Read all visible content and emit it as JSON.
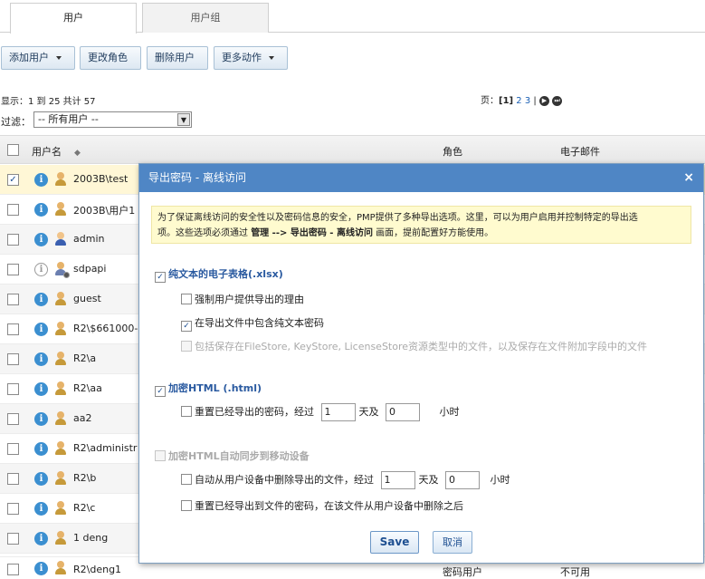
{
  "tabs": [
    {
      "label": "用户"
    },
    {
      "label": "用户组"
    }
  ],
  "toolbar": {
    "add_user": "添加用户",
    "change_role": "更改角色",
    "delete_user": "删除用户",
    "more_actions": "更多动作"
  },
  "status": {
    "showing": "显示：1 到 25 共计 57"
  },
  "pager": {
    "label": "页：",
    "current": "[1]",
    "p2": "2",
    "p3": "3",
    "sep": "|"
  },
  "filter": {
    "label": "过滤：",
    "value": "-- 所有用户 --"
  },
  "columns": {
    "username": "用户名",
    "role": "角色",
    "email": "电子邮件"
  },
  "rows": [
    {
      "name": "2003B\\test",
      "selected": true
    },
    {
      "name": "2003B\\用户1"
    },
    {
      "name": "admin"
    },
    {
      "name": "sdpapi"
    },
    {
      "name": "guest"
    },
    {
      "name": "R2\\$661000-"
    },
    {
      "name": "R2\\a"
    },
    {
      "name": "R2\\aa"
    },
    {
      "name": "aa2"
    },
    {
      "name": "R2\\administr"
    },
    {
      "name": "R2\\b"
    },
    {
      "name": "R2\\c"
    },
    {
      "name": "1 deng"
    },
    {
      "name": "R2\\deng1",
      "role": "密码用户",
      "email": "不可用"
    }
  ],
  "dialog": {
    "title": "导出密码 - 离线访问",
    "close": "×",
    "notice_1": "为了保证离线访问的安全性以及密码信息的安全，PMP提供了多种导出选项。这里，可以为用户启用并控制特定的导出选",
    "notice_2a": "项。这些选项必须通过 ",
    "notice_2b": "管理 --> 导出密码 - 离线访问",
    "notice_2c": " 画面，提前配置好方能使用。",
    "sec1": "纯文本的电子表格(.xlsx)",
    "opt1a": "强制用户提供导出的理由",
    "opt1b": "在导出文件中包含纯文本密码",
    "opt1c": "包括保存在FileStore, KeyStore, LicenseStore资源类型中的文件，以及保存在文件附加字段中的文件",
    "sec2": "加密HTML (.html)",
    "opt2a_pre": "重置已经导出的密码，经过",
    "opt2a_val1": "1",
    "opt2a_mid": "天及",
    "opt2a_val2": "0",
    "opt2a_post": "小时",
    "sec3": "加密HTML自动同步到移动设备",
    "opt3a_pre": "自动从用户设备中删除导出的文件，经过",
    "opt3a_val1": "1",
    "opt3a_mid": "天及",
    "opt3a_val2": "0",
    "opt3a_post": "小时",
    "opt3b": "重置已经导出到文件的密码，在该文件从用户设备中删除之后",
    "save": "Save",
    "cancel": "取消"
  }
}
